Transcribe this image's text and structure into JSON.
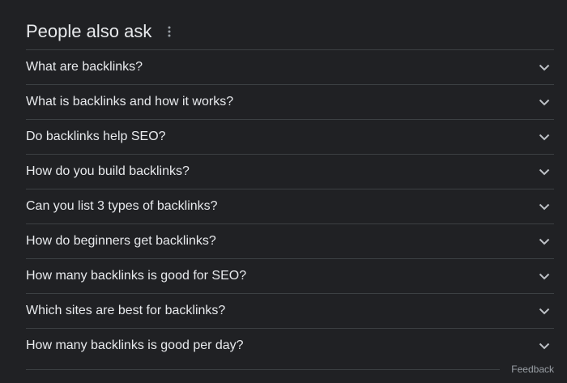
{
  "header": {
    "title": "People also ask",
    "menu_icon": "more-vert-icon"
  },
  "questions": [
    "What are backlinks?",
    "What is backlinks and how it works?",
    "Do backlinks help SEO?",
    "How do you build backlinks?",
    "Can you list 3 types of backlinks?",
    "How do beginners get backlinks?",
    "How many backlinks is good for SEO?",
    "Which sites are best for backlinks?",
    "How many backlinks is good per day?"
  ],
  "expand_icon": "chevron-down-icon",
  "footer": {
    "feedback_label": "Feedback"
  },
  "colors": {
    "background": "#202124",
    "text": "#e8eaed",
    "divider": "#3c4043",
    "muted": "#9aa0a6"
  }
}
